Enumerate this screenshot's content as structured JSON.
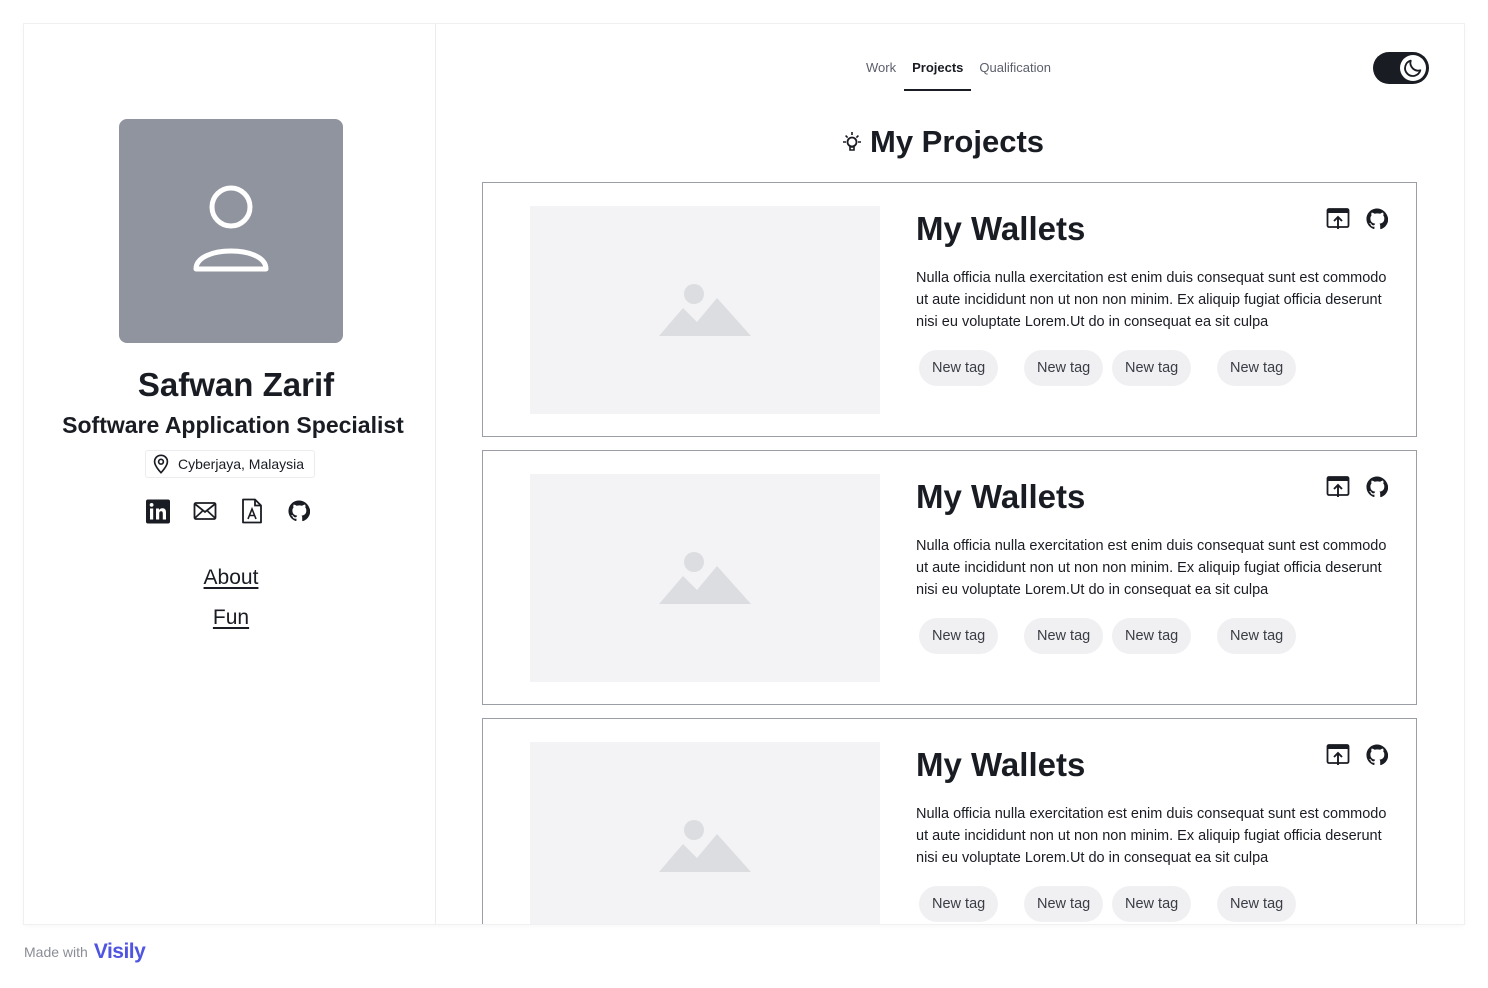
{
  "profile": {
    "name": "Safwan Zarif",
    "role": "Software Application Specialist",
    "location": "Cyberjaya, Malaysia"
  },
  "socials": [
    {
      "icon": "linkedin-icon"
    },
    {
      "icon": "mail-icon"
    },
    {
      "icon": "resume-icon"
    },
    {
      "icon": "github-icon"
    }
  ],
  "nav": {
    "about": "About",
    "fun": "Fun"
  },
  "tabs": [
    {
      "label": "Work",
      "active": false
    },
    {
      "label": "Projects",
      "active": true
    },
    {
      "label": "Qualification",
      "active": false
    }
  ],
  "theme_toggle": {
    "icon": "moon-icon",
    "dark_mode": true
  },
  "section": {
    "title": "My Projects",
    "icon": "lightbulb-icon"
  },
  "projects": [
    {
      "title": "My Wallets",
      "description": "Nulla officia nulla exercitation est enim duis consequat sunt est commodo ut aute incididunt non ut non non minim. Ex aliquip fugiat officia deserunt nisi eu voluptate Lorem.Ut do in consequat ea sit culpa",
      "tags": [
        "New tag",
        "New tag",
        "New tag",
        "New tag"
      ]
    },
    {
      "title": "My Wallets",
      "description": "Nulla officia nulla exercitation est enim duis consequat sunt est commodo ut aute incididunt non ut non non minim. Ex aliquip fugiat officia deserunt nisi eu voluptate Lorem.Ut do in consequat ea sit culpa",
      "tags": [
        "New tag",
        "New tag",
        "New tag",
        "New tag"
      ]
    },
    {
      "title": "My Wallets",
      "description": "Nulla officia nulla exercitation est enim duis consequat sunt est commodo ut aute incididunt non ut non non minim. Ex aliquip fugiat officia deserunt nisi eu voluptate Lorem.Ut do in consequat ea sit culpa",
      "tags": [
        "New tag",
        "New tag",
        "New tag",
        "New tag"
      ]
    }
  ],
  "footer": {
    "made_with": "Made with",
    "brand": "Visily"
  },
  "colors": {
    "text": "#1a1c23",
    "avatar_bg": "#90949e",
    "placeholder_bg": "#f3f3f5",
    "tag_bg": "#f0f0f2",
    "brand": "#4f55e0"
  }
}
